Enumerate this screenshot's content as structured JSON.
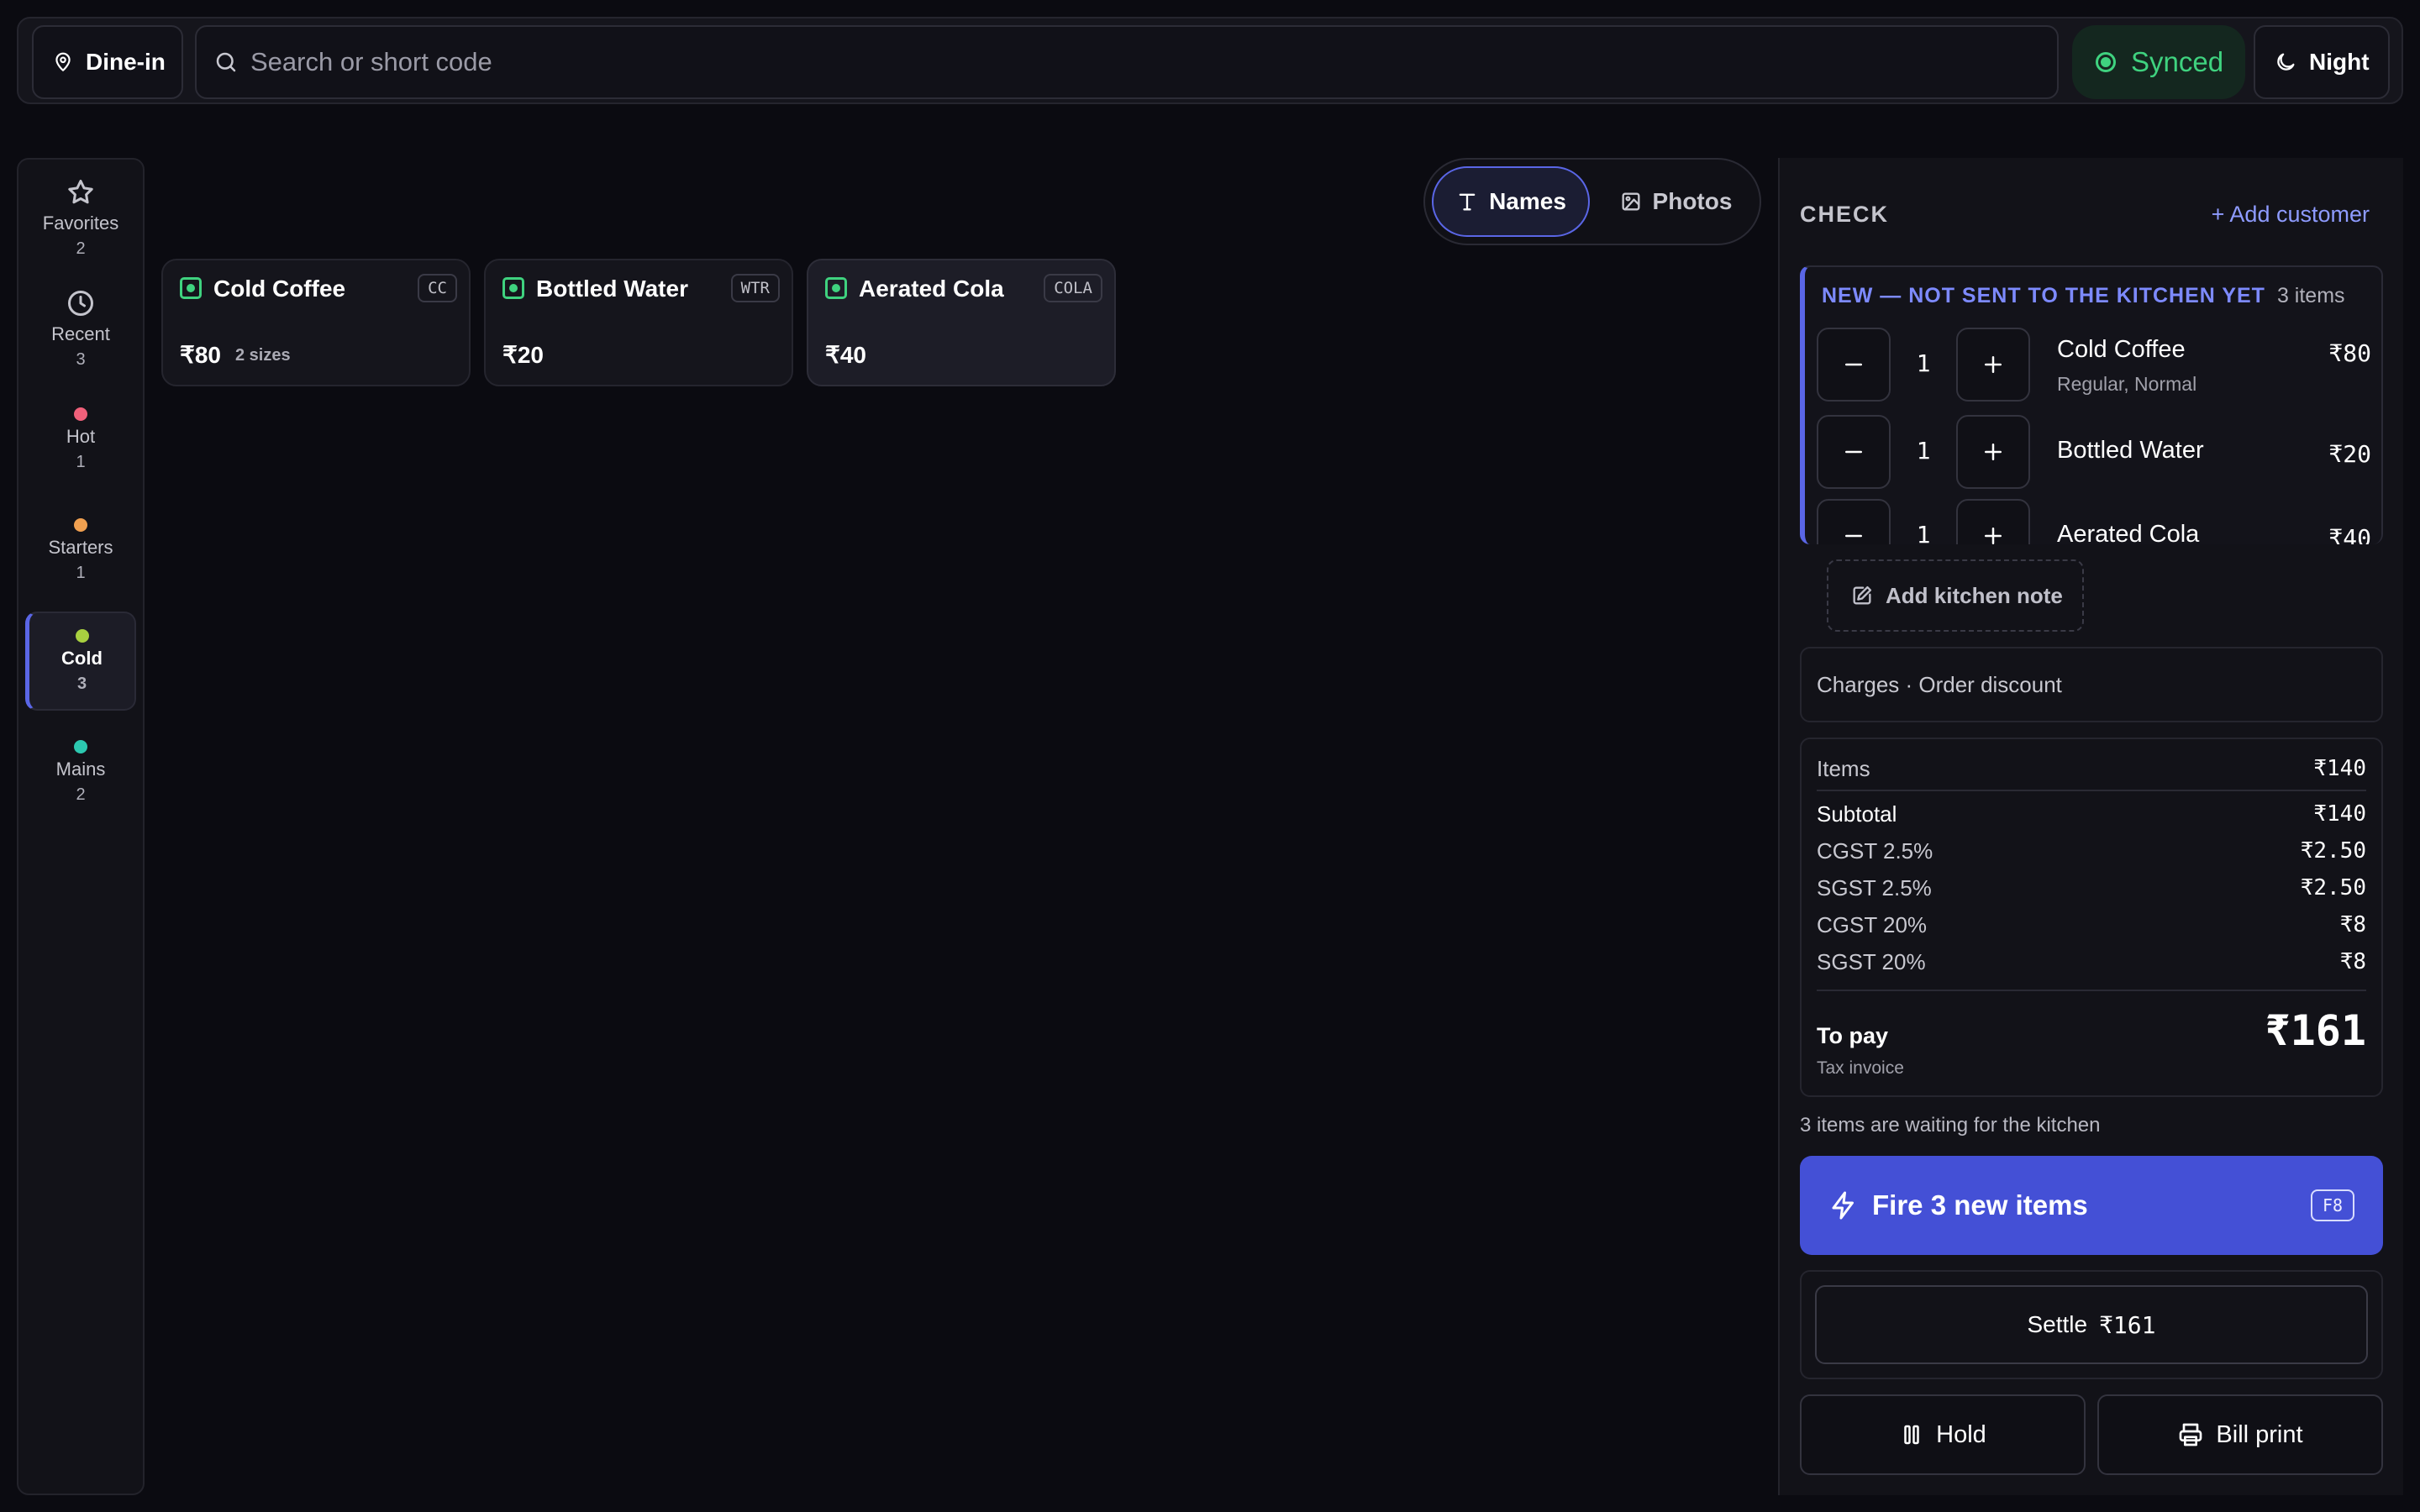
{
  "topbar": {
    "mode_label": "Dine-in",
    "search_placeholder": "Search or short code",
    "sync_status": "Synced",
    "theme_label": "Night"
  },
  "categories": [
    {
      "label": "Favorites",
      "count": "2",
      "icon": "star-icon"
    },
    {
      "label": "Recent",
      "count": "3",
      "icon": "clock-icon"
    },
    {
      "label": "Hot",
      "count": "1",
      "color": "#f0607a"
    },
    {
      "label": "Starters",
      "count": "1",
      "color": "#f0a050"
    },
    {
      "label": "Cold",
      "count": "3",
      "color": "#a8d040",
      "active": true
    },
    {
      "label": "Mains",
      "count": "2",
      "color": "#2cc8b0"
    }
  ],
  "view_toggle": {
    "names": "Names",
    "photos": "Photos",
    "selected": "Names"
  },
  "products": [
    {
      "name": "Cold Coffee",
      "code": "CC",
      "price": "₹80",
      "sizes": "2 sizes"
    },
    {
      "name": "Bottled Water",
      "code": "WTR",
      "price": "₹20"
    },
    {
      "name": "Aerated Cola",
      "code": "COLA",
      "price": "₹40"
    }
  ],
  "check": {
    "title": "CHECK",
    "add_customer": "+ Add customer",
    "new_section": {
      "heading": "NEW — NOT SENT TO THE KITCHEN YET",
      "count_label": "3 items",
      "lines": [
        {
          "name": "Cold Coffee",
          "qty": "1",
          "modifiers": "Regular, Normal",
          "price": "₹80"
        },
        {
          "name": "Bottled Water",
          "qty": "1",
          "price": "₹20"
        },
        {
          "name": "Aerated Cola",
          "qty": "1",
          "price": "₹40"
        }
      ]
    },
    "kitchen_note": "Add kitchen note",
    "charges": "Charges · Order discount",
    "summary": {
      "items_label": "Items",
      "items_value": "₹140",
      "subtotal_label": "Subtotal",
      "subtotal_value": "₹140",
      "taxes": [
        {
          "label": "CGST 2.5%",
          "value": "₹2.50"
        },
        {
          "label": "SGST 2.5%",
          "value": "₹2.50"
        },
        {
          "label": "CGST 20%",
          "value": "₹8"
        },
        {
          "label": "SGST 20%",
          "value": "₹8"
        }
      ],
      "to_pay_label": "To pay",
      "to_pay_value": "₹161",
      "invoice_type": "Tax invoice"
    },
    "waiting_text": "3 items are waiting for the kitchen",
    "fire_label": "Fire 3 new items",
    "fire_shortcut": "F8",
    "settle_label": "Settle",
    "settle_amount": "₹161",
    "hold_label": "Hold",
    "bill_print_label": "Bill print"
  },
  "colors": {
    "accent": "#5a66e6",
    "fire_button": "#4450d6",
    "synced_green": "#3fd27f",
    "link": "#8e9bff"
  }
}
